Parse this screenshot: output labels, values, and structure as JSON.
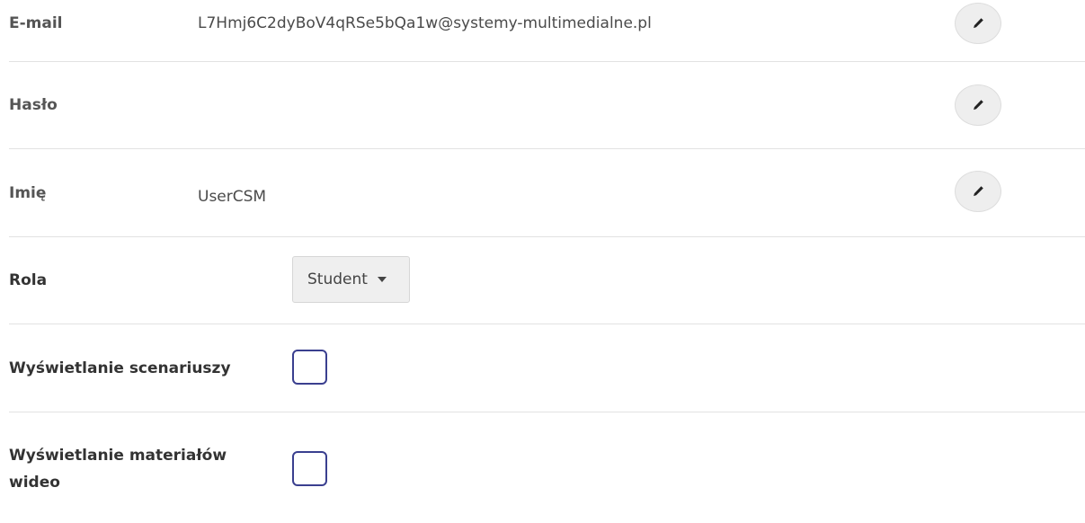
{
  "fields": {
    "email": {
      "label": "E-mail",
      "value": "L7Hmj6C2dyBoV4qRSe5bQa1w@systemy-multimedialne.pl"
    },
    "password": {
      "label": "Hasło"
    },
    "name": {
      "label": "Imię",
      "value": "UserCSM"
    },
    "role": {
      "label": "Rola",
      "selected": "Student"
    },
    "scenarios": {
      "label": "Wyświetlanie scenariuszy",
      "checked": false
    },
    "videos": {
      "label": "Wyświetlanie materiałów wideo",
      "checked": false
    }
  },
  "icons": {
    "edit": "pencil-icon",
    "dropdown": "caret-down-icon"
  },
  "colors": {
    "checkbox_border": "#3a3f8f",
    "edit_button_bg": "#eeeeee",
    "divider": "#e2e2e2"
  }
}
